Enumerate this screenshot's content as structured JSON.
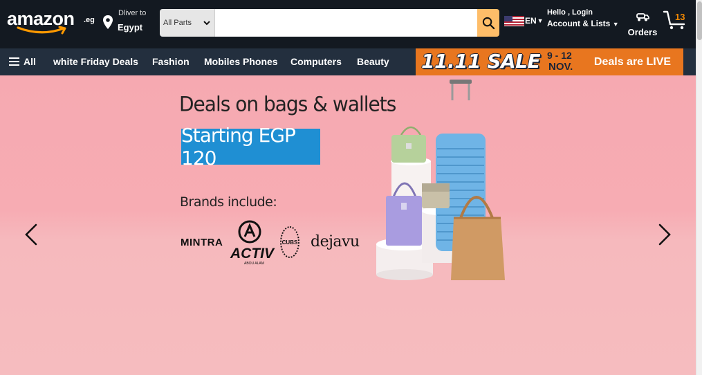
{
  "header": {
    "logo_text": "amazon",
    "logo_tld": ".eg",
    "deliver_line1": "Dliver to",
    "deliver_line2": "Egypt",
    "search": {
      "category": "All Parts",
      "placeholder": ""
    },
    "language": "EN",
    "account_line1": "Hello , Login",
    "account_line2": "Account & Lists",
    "orders_label": "Orders",
    "cart_count": "13"
  },
  "nav": {
    "all_label": "All",
    "items": [
      "white Friday Deals",
      "Fashion",
      "Mobiles Phones",
      "Computers",
      "Beauty"
    ],
    "promo": {
      "headline": "11.11 SALE",
      "dates_line1": "9 - 12",
      "dates_line2": "NOV.",
      "cta": "Deals are LIVE"
    }
  },
  "hero": {
    "title": "Deals on bags & wallets",
    "price_badge": "Starting EGP 120",
    "brands_label": "Brands include:",
    "brands": [
      "MINTRA",
      "ACTIV",
      "CUBS",
      "dejavu"
    ],
    "brand_sub": "ABOU ALAM"
  },
  "icons": {
    "search": "search-icon",
    "location": "location-pin-icon",
    "cart": "cart-icon",
    "orders": "truck-icon",
    "prev": "chevron-left-icon",
    "next": "chevron-right-icon"
  },
  "colors": {
    "topbar": "#131921",
    "navbar": "#232f3e",
    "search_button": "#febd69",
    "promo": "#e8761f",
    "hero_bg": "#f7acb3",
    "price_badge": "#1f8fd3",
    "cart_count": "#f08804"
  }
}
